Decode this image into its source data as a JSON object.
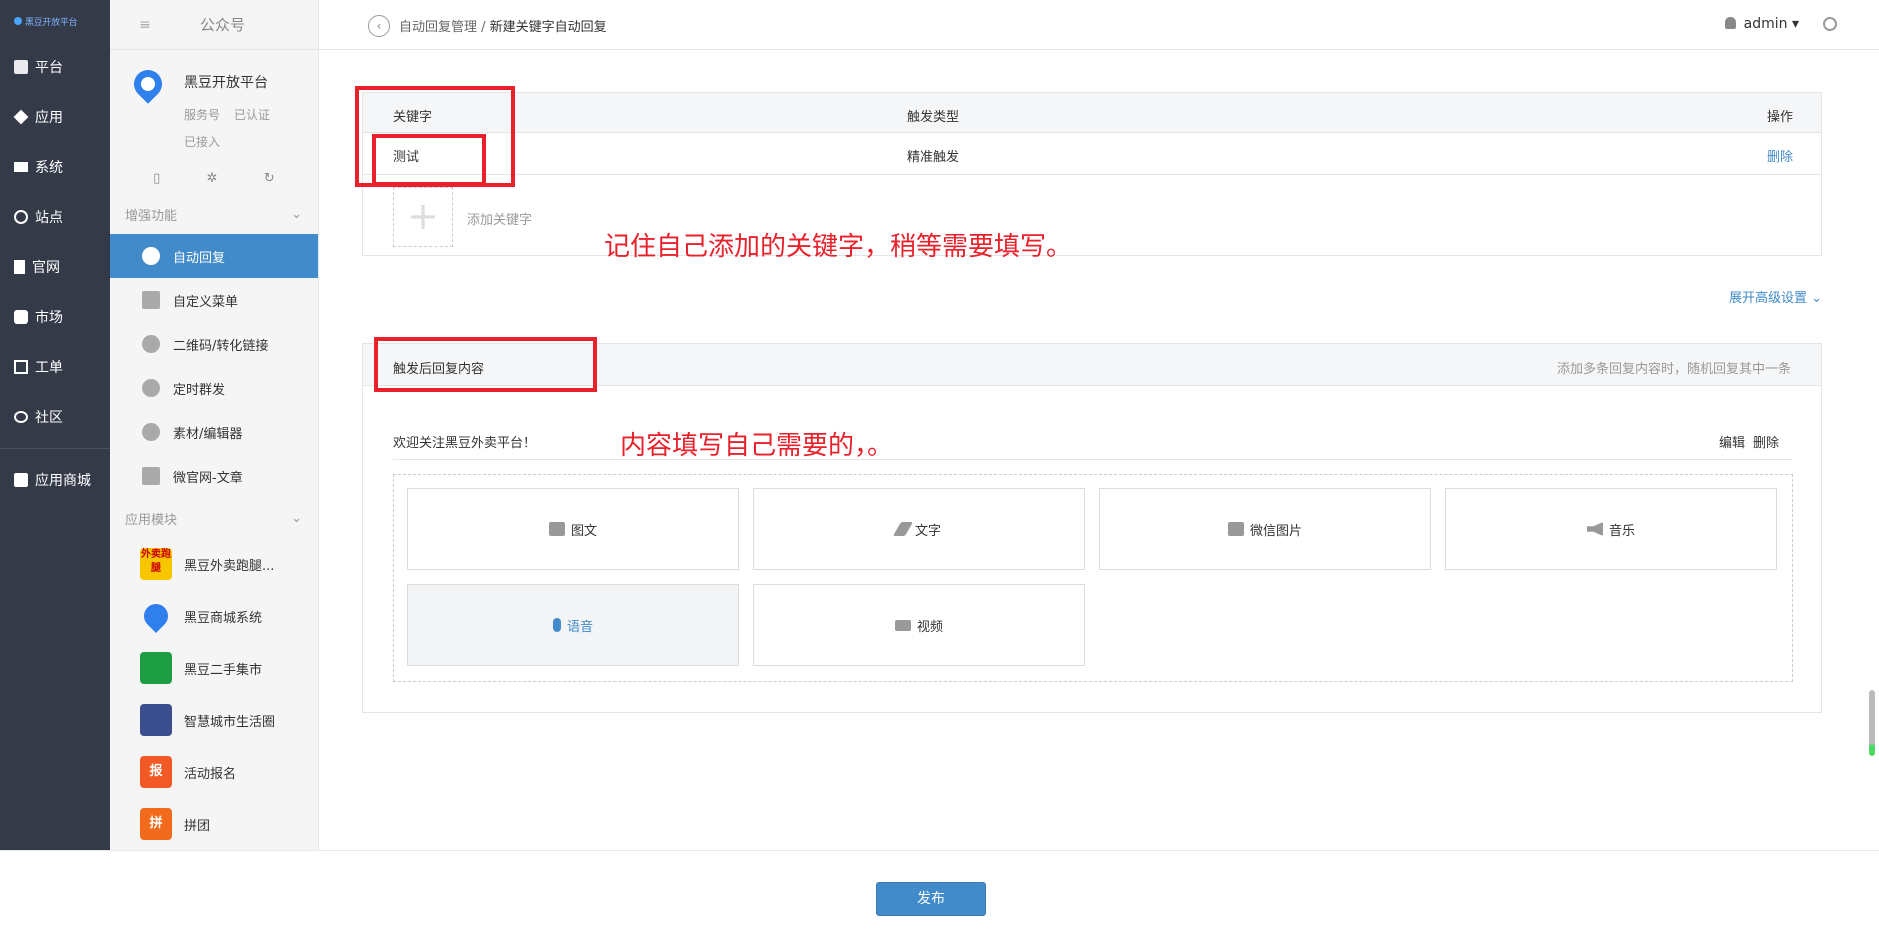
{
  "nav": {
    "logo": "黑豆开放平台",
    "items": [
      {
        "label": "平台"
      },
      {
        "label": "应用"
      },
      {
        "label": "系统"
      },
      {
        "label": "站点"
      },
      {
        "label": "官网"
      },
      {
        "label": "市场"
      },
      {
        "label": "工单"
      },
      {
        "label": "社区"
      }
    ],
    "store": "应用商城"
  },
  "sidebar": {
    "title": "公众号",
    "account": {
      "name": "黑豆开放平台",
      "type": "服务号",
      "verified": "已认证",
      "connected": "已接入"
    },
    "enhance_group": "增强功能",
    "enhance_items": [
      {
        "label": "自动回复",
        "active": true
      },
      {
        "label": "自定义菜单"
      },
      {
        "label": "二维码/转化链接"
      },
      {
        "label": "定时群发"
      },
      {
        "label": "素材/编辑器"
      },
      {
        "label": "微官网-文章"
      }
    ],
    "apps_group": "应用模块",
    "apps": [
      {
        "label": "黑豆外卖跑腿...",
        "color": "#f7c600",
        "icon_text": "外卖跑腿"
      },
      {
        "label": "黑豆商城系统",
        "color": "#2f80ed"
      },
      {
        "label": "黑豆二手集市",
        "color": "#1e9e43"
      },
      {
        "label": "智慧城市生活圈",
        "color": "#3b4f8f"
      },
      {
        "label": "活动报名",
        "color": "#f15a24",
        "icon_text": "报"
      },
      {
        "label": "拼团",
        "color": "#f26b1d",
        "icon_text": "拼"
      }
    ]
  },
  "header": {
    "breadcrumb_parent": "自动回复管理 /",
    "breadcrumb_current": "新建关键字自动回复",
    "user": "admin"
  },
  "keywords": {
    "col_keyword": "关键字",
    "col_trigger": "触发类型",
    "col_action": "操作",
    "rows": [
      {
        "keyword": "测试",
        "trigger": "精准触发",
        "action": "删除"
      }
    ],
    "add_label": "添加关键字",
    "plus": "+"
  },
  "advanced": "展开高级设置",
  "reply": {
    "title": "触发后回复内容",
    "hint": "添加多条回复内容时，随机回复其中一条",
    "content": "欢迎关注黑豆外卖平台！",
    "edit": "编辑",
    "delete": "删除",
    "types": [
      {
        "label": "图文",
        "icon": "image-text-icon"
      },
      {
        "label": "文字",
        "icon": "pencil-icon"
      },
      {
        "label": "微信图片",
        "icon": "picture-icon"
      },
      {
        "label": "音乐",
        "icon": "speaker-icon"
      },
      {
        "label": "语音",
        "icon": "microphone-icon",
        "selected": true
      },
      {
        "label": "视频",
        "icon": "video-icon"
      }
    ]
  },
  "annotations": {
    "note1": "记住自己添加的关键字，稍等需要填写。",
    "note2": "内容填写自己需要的，。"
  },
  "footer": {
    "publish": "发布"
  },
  "colors": {
    "accent": "#428bca",
    "nav_bg": "#353a49",
    "annotation": "#e8212b"
  }
}
